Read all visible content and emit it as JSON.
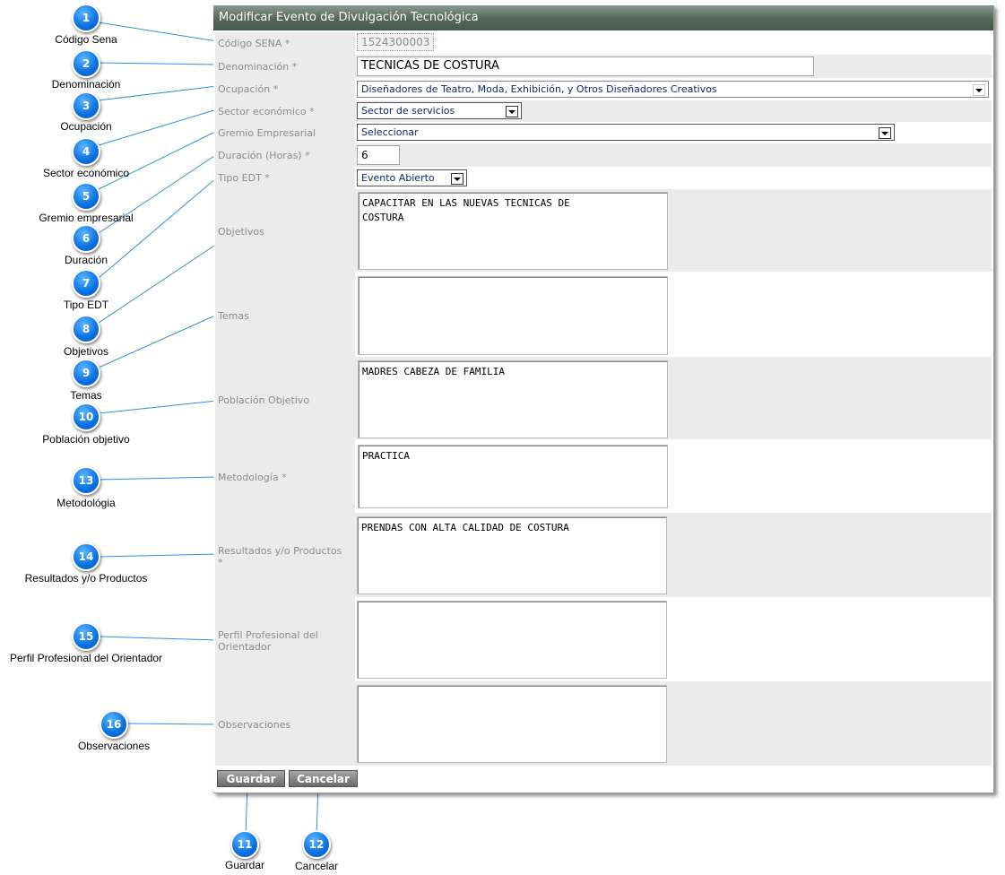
{
  "form": {
    "title": "Modificar Evento de Divulgación Tecnológica",
    "codigo": {
      "label": "Código SENA *",
      "value": "1524300003"
    },
    "denominacion": {
      "label": "Denominación *",
      "value": "TECNICAS DE COSTURA"
    },
    "ocupacion": {
      "label": "Ocupación *",
      "value": "Diseñadores de Teatro, Moda, Exhibición, y Otros Diseñadores Creativos"
    },
    "sector": {
      "label": "Sector económico *",
      "value": "Sector de servicios"
    },
    "gremio": {
      "label": "Gremio Empresarial",
      "value": "Seleccionar"
    },
    "duracion": {
      "label": "Duración (Horas) *",
      "value": "6"
    },
    "tipo": {
      "label": "Tipo EDT *",
      "value": "Evento Abierto"
    },
    "objetivos": {
      "label": "Objetivos",
      "value": "CAPACITAR EN LAS NUEVAS TECNICAS DE\nCOSTURA"
    },
    "temas": {
      "label": "Temas",
      "value": ""
    },
    "poblacion": {
      "label": "Población Objetivo",
      "value": "MADRES CABEZA DE FAMILIA"
    },
    "metodologia": {
      "label": "Metodología *",
      "value": "PRACTICA"
    },
    "resultados": {
      "label": "Resultados y/o Productos\n*",
      "value": "PRENDAS CON ALTA CALIDAD DE COSTURA"
    },
    "perfil": {
      "label": "Perfil Profesional del\nOrientador",
      "value": ""
    },
    "observaciones": {
      "label": "Observaciones",
      "value": ""
    },
    "guardar_label": "Guardar",
    "cancelar_label": "Cancelar"
  },
  "callouts": [
    {
      "num": "1",
      "label": "Código Sena"
    },
    {
      "num": "2",
      "label": "Denominación"
    },
    {
      "num": "3",
      "label": "Ocupación"
    },
    {
      "num": "4",
      "label": "Sector económico"
    },
    {
      "num": "5",
      "label": "Gremio empresarial"
    },
    {
      "num": "6",
      "label": "Duración"
    },
    {
      "num": "7",
      "label": "Tipo EDT"
    },
    {
      "num": "8",
      "label": "Objetivos"
    },
    {
      "num": "9",
      "label": "Temas"
    },
    {
      "num": "10",
      "label": "Población objetivo"
    },
    {
      "num": "13",
      "label": "Metodológia"
    },
    {
      "num": "14",
      "label": "Resultados y/o Productos"
    },
    {
      "num": "15",
      "label": "Perfil Profesional del Orientador"
    },
    {
      "num": "16",
      "label": "Observaciones"
    },
    {
      "num": "11",
      "label": "Guardar"
    },
    {
      "num": "12",
      "label": "Cancelar"
    }
  ],
  "colors": {
    "bubble": "#0a6fe0",
    "connector": "#2f8fe6",
    "title_bar": "#536657"
  }
}
